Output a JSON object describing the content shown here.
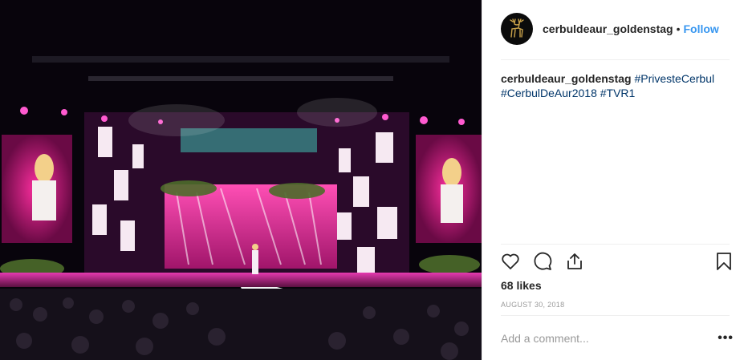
{
  "post": {
    "username": "cerbuldeaur_goldenstag",
    "separator": "•",
    "follow_label": "Follow",
    "caption": {
      "username": "cerbuldeaur_goldenstag",
      "hashtags": [
        "#PrivesteCerbul",
        "#CerbulDeAur2018",
        "#TVR1"
      ]
    },
    "likes": "68 likes",
    "date": "AUGUST 30, 2018",
    "comment_placeholder": "Add a comment...",
    "more_label": "•••"
  },
  "icons": {
    "avatar": "golden-stag-logo",
    "like": "heart-icon",
    "comment": "comment-icon",
    "share": "share-icon",
    "save": "bookmark-icon"
  },
  "colors": {
    "follow": "#3897f0",
    "hashtag": "#003569",
    "meta": "#999999",
    "stage_pink": "#e0147c",
    "stage_purple": "#7a1fa8"
  }
}
